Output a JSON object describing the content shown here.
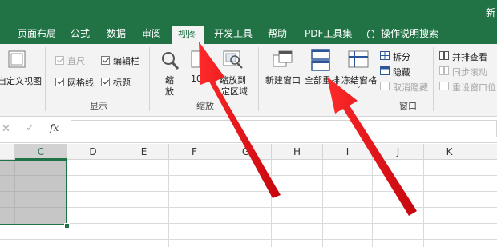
{
  "window": {
    "title_partial": "新"
  },
  "tabs": [
    {
      "label": "页面布局"
    },
    {
      "label": "公式"
    },
    {
      "label": "数据"
    },
    {
      "label": "审阅"
    },
    {
      "label": "视图",
      "active": true
    },
    {
      "label": "开发工具"
    },
    {
      "label": "帮助"
    },
    {
      "label": "PDF工具集"
    },
    {
      "label": "操作说明搜索",
      "icon": "lightbulb-icon"
    }
  ],
  "ribbon": {
    "custom_view": "自定义视图",
    "show_group": {
      "label": "显示",
      "ruler": {
        "label": "直尺",
        "checked": true,
        "disabled": true
      },
      "formula_bar": {
        "label": "编辑栏",
        "checked": true
      },
      "gridlines": {
        "label": "网格线",
        "checked": true
      },
      "headings": {
        "label": "标题",
        "checked": true
      }
    },
    "zoom_group": {
      "label": "缩放",
      "zoom_line1": "缩",
      "zoom_line2": "放",
      "hundred": "10",
      "zoom_sel_line1": "缩放到",
      "zoom_sel_line2": "定区域"
    },
    "window_group": {
      "label": "窗口",
      "new_window": "新建窗口",
      "arrange_all": "全部重排",
      "freeze_panes": "冻结窗格",
      "split": "拆分",
      "hide": "隐藏",
      "unhide": "取消隐藏",
      "view_side_by_side": "并排查看",
      "sync_scroll": "同步滚动",
      "reset_position": "重设窗口位"
    }
  },
  "formula_bar": {
    "cancel": "✕",
    "enter": "✓",
    "fx": "fx",
    "value": ""
  },
  "columns": [
    "C",
    "D",
    "E",
    "F",
    "G",
    "H",
    "I",
    "J",
    "K"
  ],
  "colors": {
    "accent": "#217346",
    "arrow": "#e8141a",
    "selection": "#c6c6c6"
  }
}
